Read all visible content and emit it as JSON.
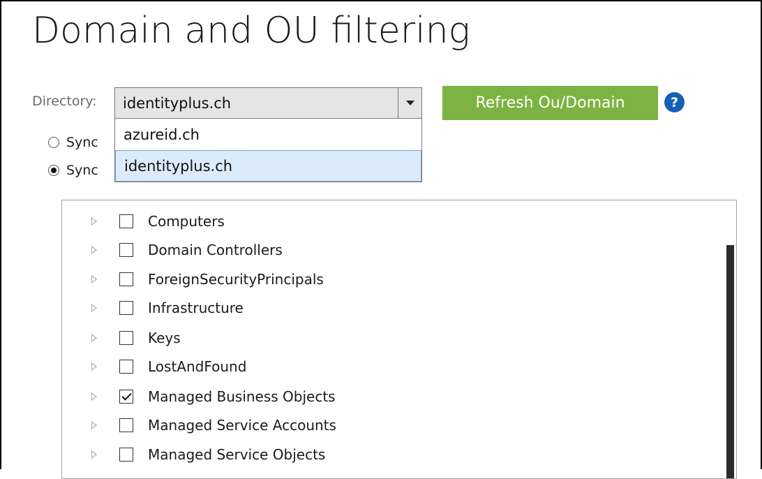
{
  "page": {
    "title": "Domain and OU filtering"
  },
  "directory": {
    "label": "Directory:",
    "selected": "identityplus.ch",
    "options": [
      "azureid.ch",
      "identityplus.ch"
    ]
  },
  "refresh_button": "Refresh Ou/Domain",
  "help": "?",
  "radios": [
    {
      "label": "Sync",
      "checked": false
    },
    {
      "label": "Sync",
      "checked": true
    }
  ],
  "tree": {
    "items": [
      {
        "label": "Computers",
        "checked": false
      },
      {
        "label": "Domain Controllers",
        "checked": false
      },
      {
        "label": "ForeignSecurityPrincipals",
        "checked": false
      },
      {
        "label": "Infrastructure",
        "checked": false
      },
      {
        "label": "Keys",
        "checked": false
      },
      {
        "label": "LostAndFound",
        "checked": false
      },
      {
        "label": "Managed Business Objects",
        "checked": true
      },
      {
        "label": "Managed Service Accounts",
        "checked": false
      },
      {
        "label": "Managed Service Objects",
        "checked": false
      }
    ]
  },
  "colors": {
    "refresh_bg": "#7cb342",
    "help_bg": "#1560b5",
    "selected_option_bg": "#dcebfb"
  }
}
